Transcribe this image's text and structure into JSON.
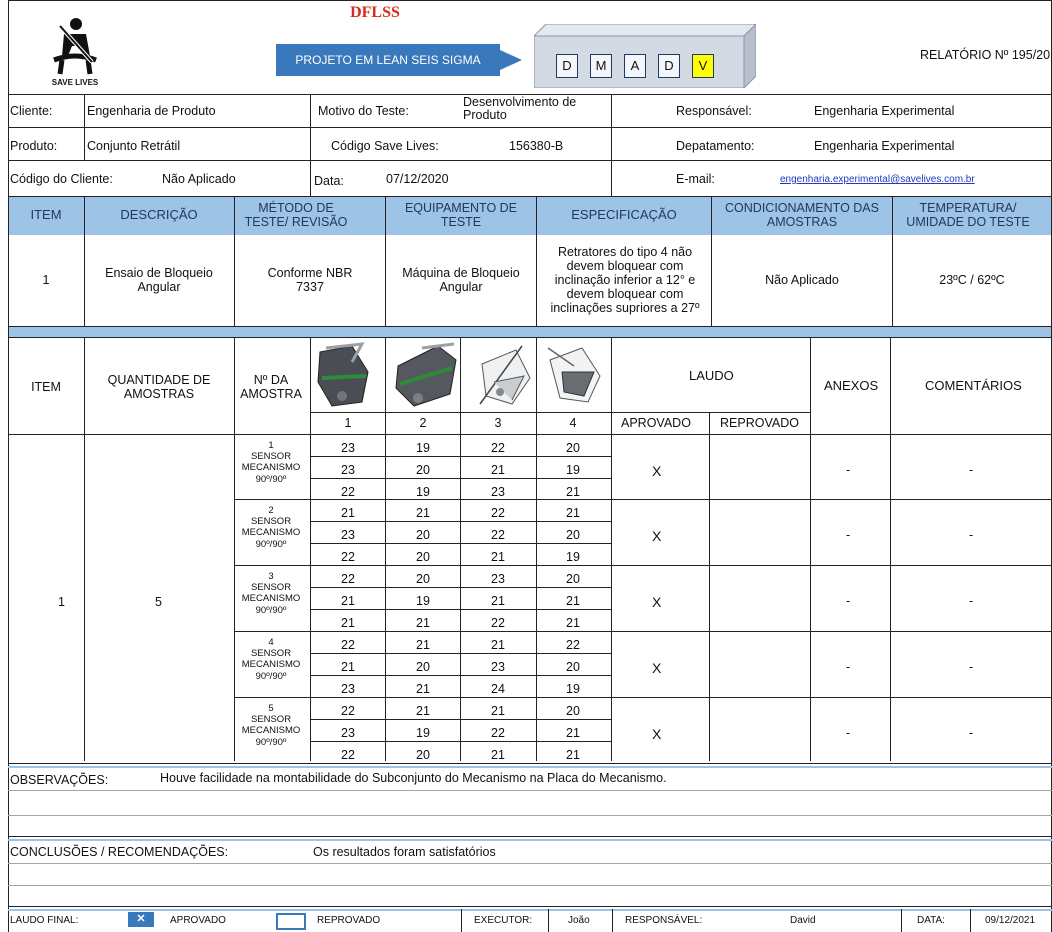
{
  "header": {
    "logo_text": "SAVE LIVES",
    "program_title": "DFLSS",
    "program_banner": "PROJETO EM LEAN SEIS SIGMA",
    "phases": [
      "D",
      "M",
      "A",
      "D",
      "V"
    ],
    "report_number": "RELATÓRIO Nº 195/20"
  },
  "info": {
    "cliente_label": "Cliente:",
    "cliente_value": "Engenharia de Produto",
    "motivo_label": "Motivo do Teste:",
    "motivo_value": "Desenvolvimento de Produto",
    "responsavel_label": "Responsável:",
    "responsavel_value": "Engenharia Experimental",
    "produto_label": "Produto:",
    "produto_value": "Conjunto Retrátil",
    "codigo_sl_label": "Código Save Lives:",
    "codigo_sl_value": "156380-B",
    "departamento_label": "Depatamento:",
    "departamento_value": "Engenharia Experimental",
    "codigo_cliente_label": "Código do Cliente:",
    "codigo_cliente_value": "Não Aplicado",
    "data_label": "Data:",
    "data_value": "07/12/2020",
    "email_label": "E-mail:",
    "email_value": "engenharia.experimental@savelives.com.br"
  },
  "test_header": {
    "item": "ITEM",
    "descricao": "DESCRIÇÃO",
    "metodo": "MÉTODO DE TESTE/ REVISÃO",
    "equipamento": "EQUIPAMENTO DE TESTE",
    "especificacao": "ESPECIFICAÇÃO",
    "condicionamento": "CONDICIONAMENTO DAS AMOSTRAS",
    "temperatura": "TEMPERATURA/ UMIDADE DO TESTE"
  },
  "test_row": {
    "item": "1",
    "descricao": "Ensaio de Bloqueio Angular",
    "metodo": "Conforme NBR 7337",
    "equipamento": "Máquina de Bloqueio Angular",
    "especificacao": "Retratores do tipo 4 não devem bloquear com inclinação inferior a 12° e devem bloquear com inclinações supriores a 27º",
    "condicionamento": "Não Aplicado",
    "temperatura": "23ºC / 62ºC"
  },
  "results_header": {
    "item": "ITEM",
    "quantidade": "QUANTIDADE DE AMOSTRAS",
    "n_amostra": "Nº DA AMOSTRA",
    "columns": [
      "1",
      "2",
      "3",
      "4"
    ],
    "laudo": "LAUDO",
    "aprovado": "APROVADO",
    "reprovado": "REPROVADO",
    "anexos": "ANEXOS",
    "comentarios": "COMENTÁRIOS"
  },
  "results": {
    "item": "1",
    "quantidade": "5",
    "samples": [
      {
        "number": "1",
        "sensor": "SENSOR",
        "mecanismo": "MECANISMO",
        "angle": "90º/90º",
        "rows": [
          [
            "23",
            "19",
            "22",
            "20"
          ],
          [
            "23",
            "20",
            "21",
            "19"
          ],
          [
            "22",
            "19",
            "23",
            "21"
          ]
        ],
        "aprovado": "X",
        "anexos": "-",
        "comentarios": "-"
      },
      {
        "number": "2",
        "sensor": "SENSOR",
        "mecanismo": "MECANISMO",
        "angle": "90º/90º",
        "rows": [
          [
            "21",
            "21",
            "22",
            "21"
          ],
          [
            "23",
            "20",
            "22",
            "20"
          ],
          [
            "22",
            "20",
            "21",
            "19"
          ]
        ],
        "aprovado": "X",
        "anexos": "-",
        "comentarios": "-"
      },
      {
        "number": "3",
        "sensor": "SENSOR",
        "mecanismo": "MECANISMO",
        "angle": "90º/90º",
        "rows": [
          [
            "22",
            "20",
            "23",
            "20"
          ],
          [
            "21",
            "19",
            "21",
            "21"
          ],
          [
            "21",
            "21",
            "22",
            "21"
          ]
        ],
        "aprovado": "X",
        "anexos": "-",
        "comentarios": "-"
      },
      {
        "number": "4",
        "sensor": "SENSOR",
        "mecanismo": "MECANISMO",
        "angle": "90º/90º",
        "rows": [
          [
            "22",
            "21",
            "21",
            "22"
          ],
          [
            "21",
            "20",
            "23",
            "20"
          ],
          [
            "23",
            "21",
            "24",
            "19"
          ]
        ],
        "aprovado": "X",
        "anexos": "-",
        "comentarios": "-"
      },
      {
        "number": "5",
        "sensor": "SENSOR",
        "mecanismo": "MECANISMO",
        "angle": "90º/90º",
        "rows": [
          [
            "22",
            "21",
            "21",
            "20"
          ],
          [
            "23",
            "19",
            "22",
            "21"
          ],
          [
            "22",
            "20",
            "21",
            "21"
          ]
        ],
        "aprovado": "X",
        "anexos": "-",
        "comentarios": "-"
      }
    ]
  },
  "observacoes": {
    "label": "OBSERVAÇÕES:",
    "text": "Houve facilidade na montabilidade do Subconjunto do Mecanismo na Placa do Mecanismo."
  },
  "conclusoes": {
    "label": "CONCLUSÕES / RECOMENDAÇÕES:",
    "text": "Os resultados foram satisfatórios"
  },
  "footer": {
    "laudo_final_label": "LAUDO FINAL:",
    "aprovado_label": "APROVADO",
    "aprovado_checked": true,
    "reprovado_label": "REPROVADO",
    "reprovado_checked": false,
    "executor_label": "EXECUTOR:",
    "executor_value": "João",
    "responsavel_label": "RESPONSÁVEL:",
    "responsavel_value": "David",
    "data_label": "DATA:",
    "data_value": "09/12/2021"
  },
  "colors": {
    "header_band": "#9dc3e6",
    "header_text": "#1f3864",
    "banner": "#3a78bc",
    "title_red": "#d62b1f",
    "phase_highlight": "#ffff00",
    "link": "#1f3bbf"
  }
}
